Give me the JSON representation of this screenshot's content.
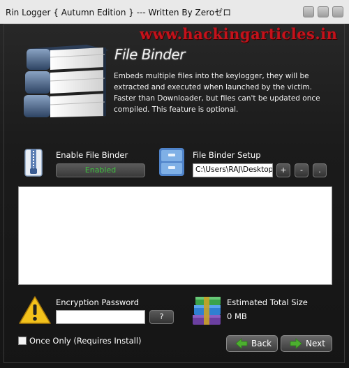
{
  "window": {
    "title": "Rin Logger  { Autumn Edition } --- Written By Zeroゼロ",
    "controls": [
      "minimize-button",
      "maximize-button",
      "close-button"
    ]
  },
  "watermark": "www.hackingarticles.in",
  "header": {
    "title": "File Binder",
    "description": "Embeds multiple files into the keylogger, they will be extracted and executed when launched by the victim. Faster than Downloader, but files can't be updated once compiled. This feature is optional."
  },
  "enable_section": {
    "label": "Enable File Binder",
    "button_label": "Enabled"
  },
  "setup_section": {
    "label": "File Binder Setup",
    "path_value": "C:\\Users\\RAJ\\Desktop",
    "add_label": "+",
    "remove_label": "-",
    "more_label": "."
  },
  "file_list": {
    "items": []
  },
  "encryption": {
    "label": "Encryption Password",
    "value": "",
    "help_label": "?"
  },
  "size": {
    "label": "Estimated Total Size",
    "value": "0 MB"
  },
  "once_only": {
    "label": "Once Only (Requires Install)",
    "checked": false
  },
  "nav": {
    "back_label": "Back",
    "next_label": "Next"
  },
  "colors": {
    "enabled_text": "#3fbf3f",
    "arrow_green": "#4caf2f",
    "watermark": "#c4121b"
  }
}
